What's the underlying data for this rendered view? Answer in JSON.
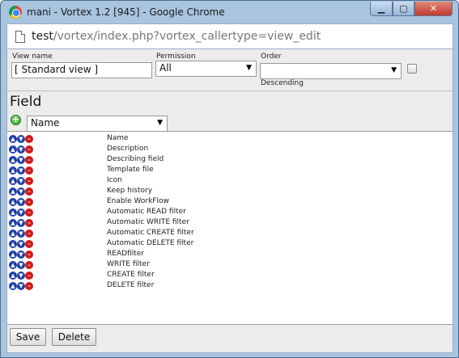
{
  "window": {
    "title": "mani - Vortex 1.2 [945] - Google Chrome",
    "minimize_glyph": "▁",
    "maximize_glyph": "▢",
    "close_glyph": "✕"
  },
  "address": {
    "host": "test",
    "path": "/vortex/index.php?vortex_callertype=view_edit"
  },
  "form": {
    "view_name_label": "View name",
    "view_name_value": "[ Standard view ]",
    "permission_label": "Permission",
    "permission_value": "All",
    "order_label": "Order",
    "order_value": "",
    "descending_label": "Descending",
    "arrow": "▼"
  },
  "field": {
    "title": "Field",
    "add_glyph": "+",
    "select_value": "Name",
    "items": [
      "Name",
      "Description",
      "Describing field",
      "Template file",
      "Icon",
      "Keep history",
      "Enable WorkFlow",
      "Automatic READ filter",
      "Automatic WRITE filter",
      "Automatic CREATE filter",
      "Automatic DELETE filter",
      "READfilter",
      "WRITE filter",
      "CREATE filter",
      "DELETE filter"
    ]
  },
  "buttons": {
    "save": "Save",
    "delete": "Delete"
  },
  "colors": {
    "frame": "#a9c4df",
    "close": "#c0392b",
    "move_icon": "#1f3fa8",
    "delete_icon": "#d01a1a",
    "add_icon": "#2e9a1e"
  }
}
